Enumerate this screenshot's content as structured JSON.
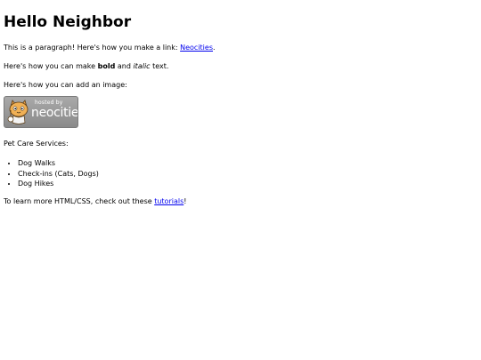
{
  "heading": "Hello Neighbor",
  "p_link": {
    "text_before": "This is a paragraph! Here's how you make a link: ",
    "link_text": "Neocities",
    "text_after": "."
  },
  "p_bold": {
    "text_before": "Here's how you can make ",
    "bold": "bold",
    "text_mid": " and ",
    "italic": "italic",
    "text_after": " text."
  },
  "p_image": "Here's how you can add an image:",
  "badge": {
    "small": "hosted by",
    "big": "neocities",
    "icon": "neocities-cat-icon"
  },
  "services": {
    "title": "Pet Care Services:",
    "items": [
      "Dog Walks",
      "Check-ins (Cats, Dogs)",
      "Dog Hikes"
    ]
  },
  "p_tutorials": {
    "text_before": "To learn more HTML/CSS, check out these ",
    "link_text": "tutorials",
    "text_after": "!"
  }
}
